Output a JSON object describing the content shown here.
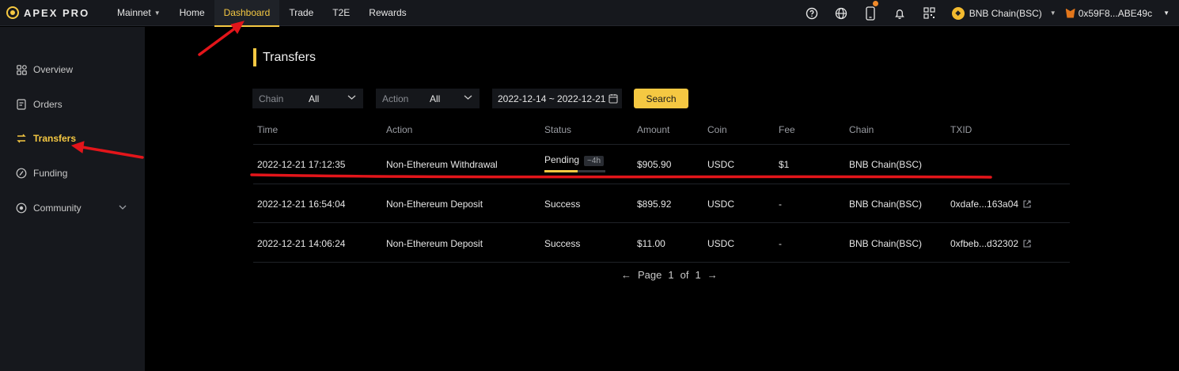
{
  "brand": {
    "logo_text": "APEX PRO"
  },
  "nav": {
    "network": "Mainnet",
    "items": [
      {
        "label": "Home"
      },
      {
        "label": "Dashboard",
        "active": true
      },
      {
        "label": "Trade"
      },
      {
        "label": "T2E"
      },
      {
        "label": "Rewards"
      }
    ],
    "chain": "BNB Chain(BSC)",
    "wallet": "0x59F8...ABE49c"
  },
  "sidebar": {
    "items": [
      {
        "label": "Overview",
        "icon": "grid-icon"
      },
      {
        "label": "Orders",
        "icon": "document-icon"
      },
      {
        "label": "Transfers",
        "icon": "transfer-icon",
        "active": true
      },
      {
        "label": "Funding",
        "icon": "funding-icon"
      },
      {
        "label": "Community",
        "icon": "community-icon"
      }
    ]
  },
  "page": {
    "title": "Transfers"
  },
  "filters": {
    "chain_label": "Chain",
    "chain_value": "All",
    "action_label": "Action",
    "action_value": "All",
    "date_range": "2022-12-14 ~ 2022-12-21",
    "search_label": "Search"
  },
  "table": {
    "headers": [
      "Time",
      "Action",
      "Status",
      "Amount",
      "Coin",
      "Fee",
      "Chain",
      "TXID"
    ],
    "rows": [
      {
        "time": "2022-12-21 17:12:35",
        "action": "Non-Ethereum Withdrawal",
        "status": "Pending",
        "eta": "~4h",
        "progress": 0.55,
        "amount": "$905.90",
        "coin": "USDC",
        "fee": "$1",
        "chain": "BNB Chain(BSC)",
        "txid": ""
      },
      {
        "time": "2022-12-21 16:54:04",
        "action": "Non-Ethereum Deposit",
        "status": "Success",
        "amount": "$895.92",
        "coin": "USDC",
        "fee": "-",
        "chain": "BNB Chain(BSC)",
        "txid": "0xdafe...163a04"
      },
      {
        "time": "2022-12-21 14:06:24",
        "action": "Non-Ethereum Deposit",
        "status": "Success",
        "amount": "$11.00",
        "coin": "USDC",
        "fee": "-",
        "chain": "BNB Chain(BSC)",
        "txid": "0xfbeb...d32302"
      }
    ]
  },
  "pagination": {
    "prefix": "Page",
    "current": "1",
    "of": "of",
    "total": "1"
  },
  "colors": {
    "accent": "#f5c842",
    "annotation": "#e3151a"
  }
}
